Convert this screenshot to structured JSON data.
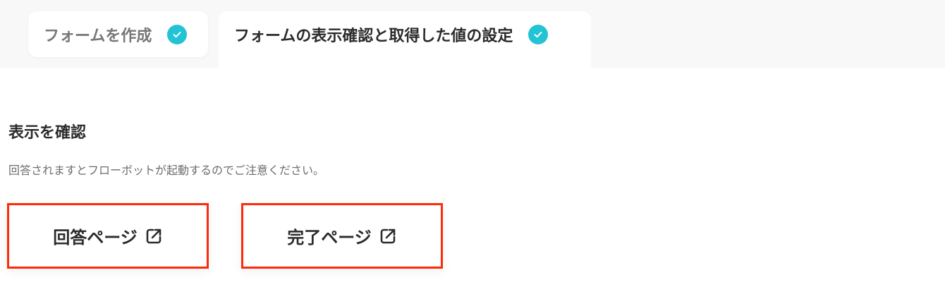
{
  "tabs": [
    {
      "label": "フォームを作成",
      "completed": true
    },
    {
      "label": "フォームの表示確認と取得した値の設定",
      "completed": true
    }
  ],
  "section": {
    "title": "表示を確認",
    "note": "回答されますとフローボットが起動するのでご注意ください。"
  },
  "buttons": {
    "answer_page": "回答ページ",
    "complete_page": "完了ページ"
  },
  "colors": {
    "check_accent": "#22c3d4",
    "highlight_border": "#ff2a0a",
    "tabbar_bg": "#f8f8f8"
  },
  "icons": {
    "tab_status": "check-circle-icon",
    "button_link": "external-link-icon"
  }
}
